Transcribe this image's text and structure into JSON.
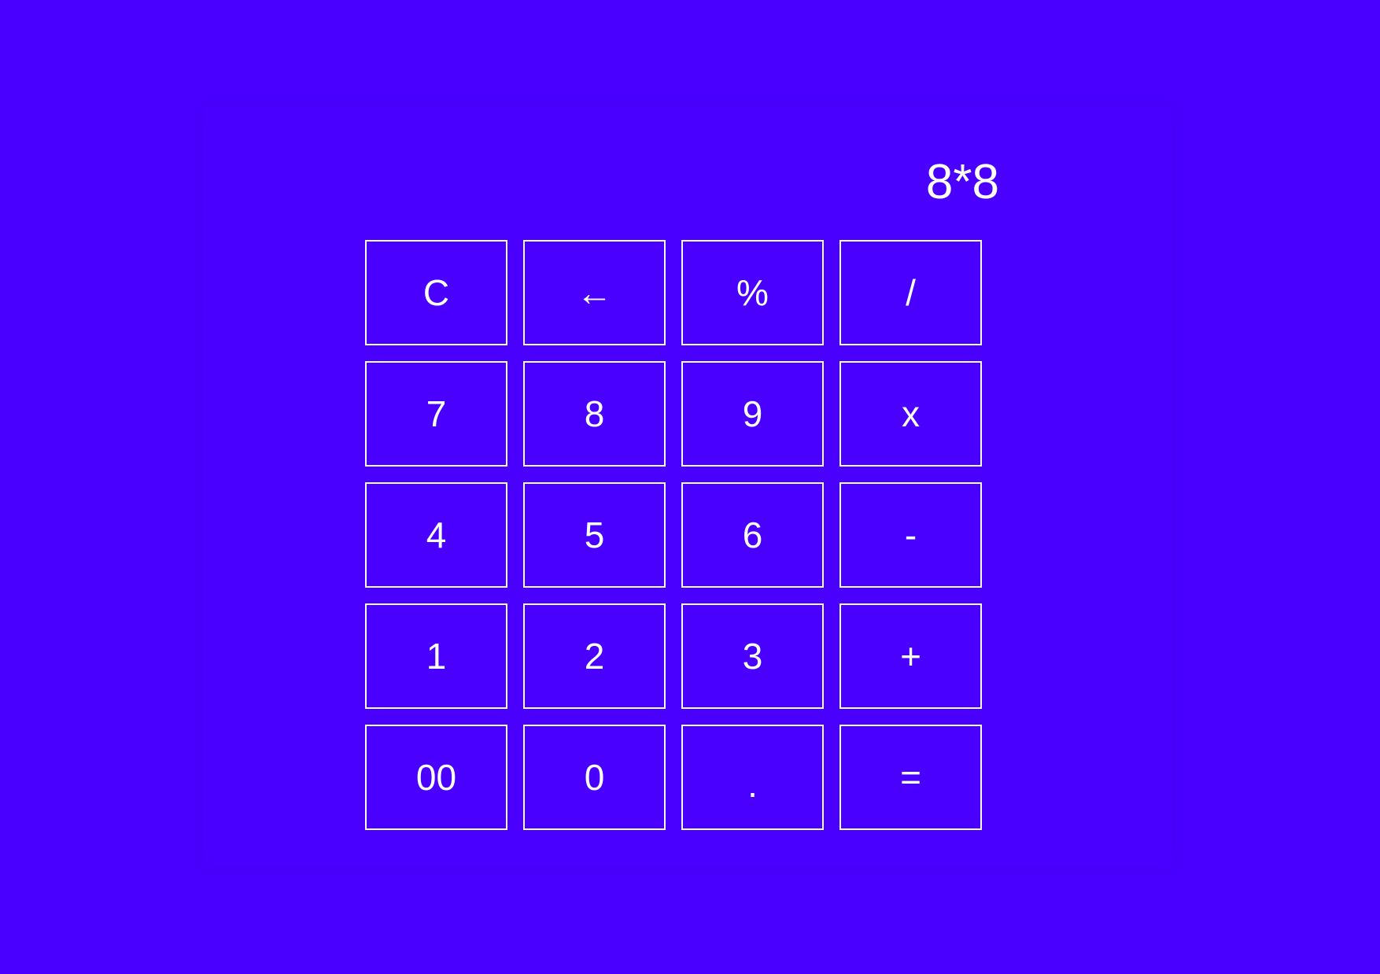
{
  "theme": {
    "background": "#4a00ff",
    "foreground": "#ffffff"
  },
  "display": {
    "expression": "8*8"
  },
  "keys": [
    {
      "label": "C",
      "name": "clear-button"
    },
    {
      "label": "←",
      "name": "backspace-button"
    },
    {
      "label": "%",
      "name": "percent-button"
    },
    {
      "label": "/",
      "name": "divide-button"
    },
    {
      "label": "7",
      "name": "digit-7-button"
    },
    {
      "label": "8",
      "name": "digit-8-button"
    },
    {
      "label": "9",
      "name": "digit-9-button"
    },
    {
      "label": "x",
      "name": "multiply-button"
    },
    {
      "label": "4",
      "name": "digit-4-button"
    },
    {
      "label": "5",
      "name": "digit-5-button"
    },
    {
      "label": "6",
      "name": "digit-6-button"
    },
    {
      "label": "-",
      "name": "subtract-button"
    },
    {
      "label": "1",
      "name": "digit-1-button"
    },
    {
      "label": "2",
      "name": "digit-2-button"
    },
    {
      "label": "3",
      "name": "digit-3-button"
    },
    {
      "label": "+",
      "name": "add-button"
    },
    {
      "label": "00",
      "name": "double-zero-button"
    },
    {
      "label": "0",
      "name": "digit-0-button"
    },
    {
      "label": ".",
      "name": "decimal-button"
    },
    {
      "label": "=",
      "name": "equals-button"
    }
  ]
}
